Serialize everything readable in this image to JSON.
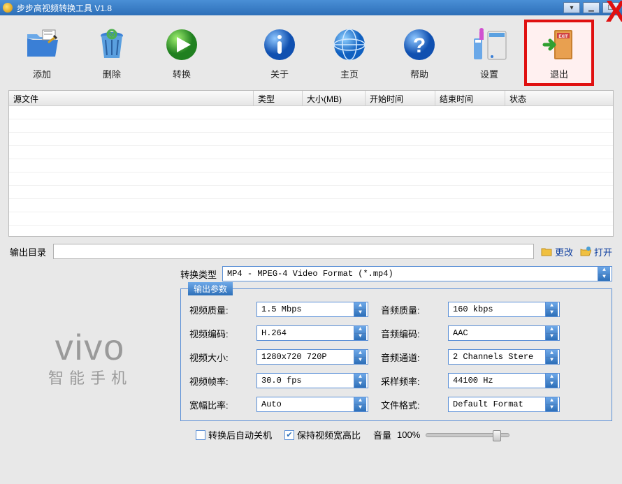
{
  "title": "步步高视频转换工具 V1.8",
  "toolbar": {
    "add": "添加",
    "delete": "删除",
    "convert": "转换",
    "about": "关于",
    "home": "主页",
    "help": "帮助",
    "settings": "设置",
    "exit": "退出"
  },
  "columns": {
    "source": "源文件",
    "type": "类型",
    "size": "大小(MB)",
    "start": "开始时间",
    "end": "结束时间",
    "status": "状态"
  },
  "output": {
    "label": "输出目录",
    "path": "",
    "change": "更改",
    "open": "打开"
  },
  "brand": {
    "logo": "vivo",
    "tagline": "智能手机"
  },
  "convert_type": {
    "label": "转换类型",
    "value": "MP4 - MPEG-4 Video Format (*.mp4)"
  },
  "params_legend": "输出参数",
  "params": {
    "video_quality_label": "视频质量:",
    "video_quality": "1.5 Mbps",
    "audio_quality_label": "音频质量:",
    "audio_quality": "160 kbps",
    "video_codec_label": "视频编码:",
    "video_codec": "H.264",
    "audio_codec_label": "音频编码:",
    "audio_codec": "AAC",
    "video_size_label": "视频大小:",
    "video_size": "1280x720 720P",
    "audio_channel_label": "音频通道:",
    "audio_channel": "2 Channels Stere",
    "video_fps_label": "视频帧率:",
    "video_fps": "30.0  fps",
    "sample_rate_label": "采样频率:",
    "sample_rate": "44100 Hz",
    "aspect_label": "宽幅比率:",
    "aspect": "Auto",
    "file_format_label": "文件格式:",
    "file_format": "Default Format"
  },
  "footer": {
    "shutdown": "转换后自动关机",
    "keep_ratio": "保持视频宽高比",
    "volume_label": "音量",
    "volume_value": "100%"
  }
}
